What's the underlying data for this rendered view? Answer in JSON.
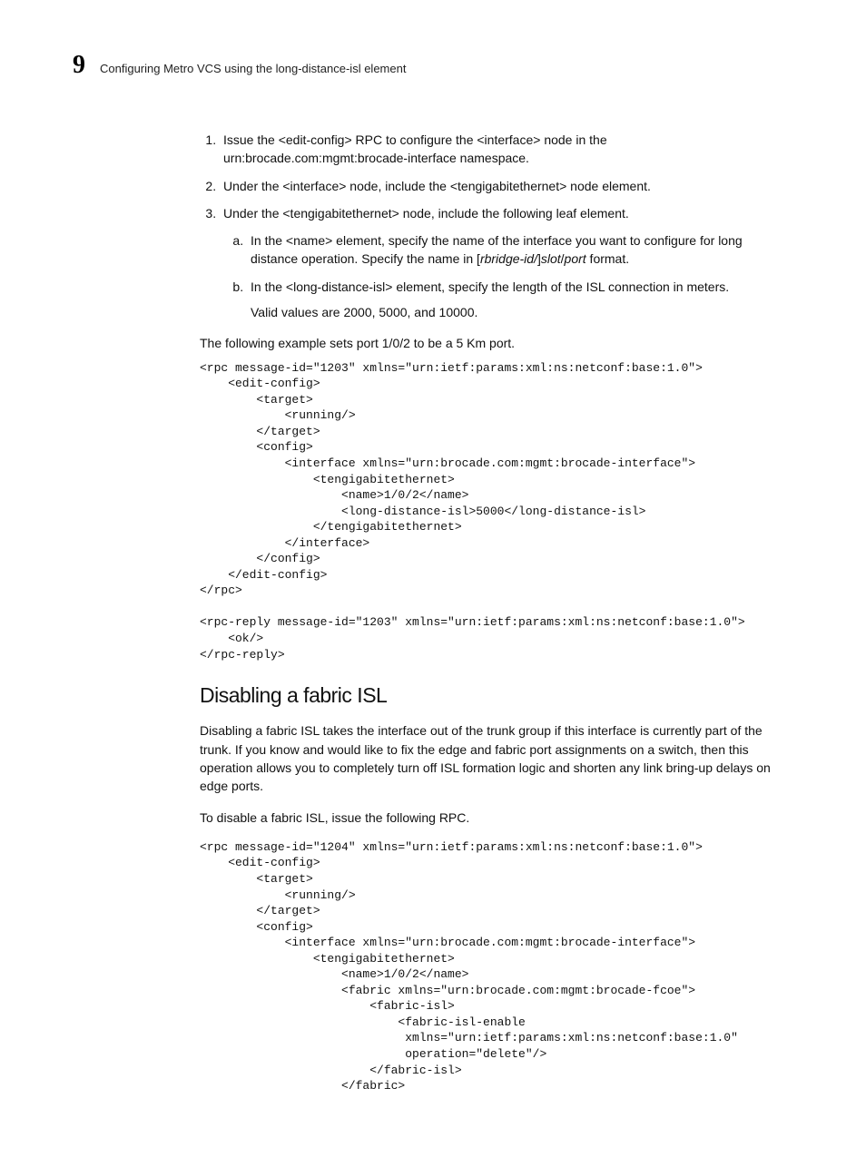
{
  "header": {
    "chapter_number": "9",
    "chapter_title": "Configuring Metro VCS using the long-distance-isl element"
  },
  "steps": {
    "s1": "Issue the <edit-config> RPC to configure the <interface> node in the urn:brocade.com:mgmt:brocade-interface namespace.",
    "s2": "Under the <interface> node, include the <tengigabitethernet> node element.",
    "s3": "Under the <tengigabitethernet> node, include the following leaf element.",
    "s3a_prefix": "In the <name> element, specify the name of the interface you want to configure for long distance operation. Specify the name in [",
    "s3a_italic1": "rbridge-id/",
    "s3a_mid": "]",
    "s3a_italic2": "slot",
    "s3a_slash": "/",
    "s3a_italic3": "port",
    "s3a_suffix": " format.",
    "s3b": "In the <long-distance-isl> element, specify the length of the ISL connection in meters.",
    "s3b_valid": "Valid values are 2000, 5000, and 10000."
  },
  "example_intro": "The following example sets port 1/0/2 to be a 5 Km port.",
  "code1": "<rpc message-id=\"1203\" xmlns=\"urn:ietf:params:xml:ns:netconf:base:1.0\">\n    <edit-config>\n        <target>\n            <running/>\n        </target>\n        <config>\n            <interface xmlns=\"urn:brocade.com:mgmt:brocade-interface\">\n                <tengigabitethernet>\n                    <name>1/0/2</name>\n                    <long-distance-isl>5000</long-distance-isl>\n                </tengigabitethernet>\n            </interface>\n        </config>\n    </edit-config>\n</rpc>\n\n<rpc-reply message-id=\"1203\" xmlns=\"urn:ietf:params:xml:ns:netconf:base:1.0\">\n    <ok/>\n</rpc-reply>",
  "section2": {
    "heading": "Disabling a fabric ISL",
    "p1": "Disabling a fabric ISL takes the interface out of the trunk group if this interface is currently part of the trunk. If you know and would like to fix the edge and fabric port assignments on a switch, then this operation allows you to completely turn off ISL formation logic and shorten any link bring-up delays on edge ports.",
    "p2": "To disable a fabric ISL, issue the following RPC."
  },
  "code2": "<rpc message-id=\"1204\" xmlns=\"urn:ietf:params:xml:ns:netconf:base:1.0\">\n    <edit-config>\n        <target>\n            <running/>\n        </target>\n        <config>\n            <interface xmlns=\"urn:brocade.com:mgmt:brocade-interface\">\n                <tengigabitethernet>\n                    <name>1/0/2</name>\n                    <fabric xmlns=\"urn:brocade.com:mgmt:brocade-fcoe\">\n                        <fabric-isl>\n                            <fabric-isl-enable\n                             xmlns=\"urn:ietf:params:xml:ns:netconf:base:1.0\"\n                             operation=\"delete\"/>\n                        </fabric-isl>\n                    </fabric>"
}
